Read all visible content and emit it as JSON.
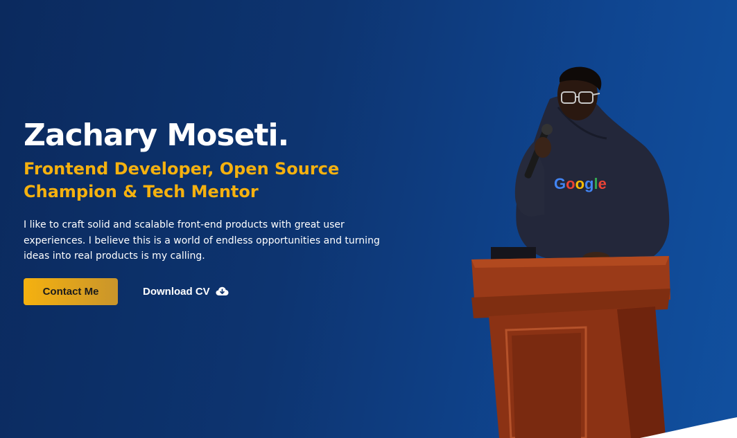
{
  "hero": {
    "name": "Zachary Moseti.",
    "tagline": "Frontend Developer, Open Source Champion & Tech Mentor",
    "bio": "I like to craft solid and scalable front-end products with great user experiences. I believe this is a world of endless opportunities and turning ideas into real products is my calling."
  },
  "actions": {
    "contact_label": "Contact Me",
    "download_label": "Download CV",
    "download_icon": "cloud-download-icon"
  },
  "photo": {
    "shirt_text": "Google"
  },
  "colors": {
    "accent": "#f5b10f",
    "background_start": "#0b2a5e",
    "background_end": "#11509f",
    "podium": "#8b2f12"
  }
}
